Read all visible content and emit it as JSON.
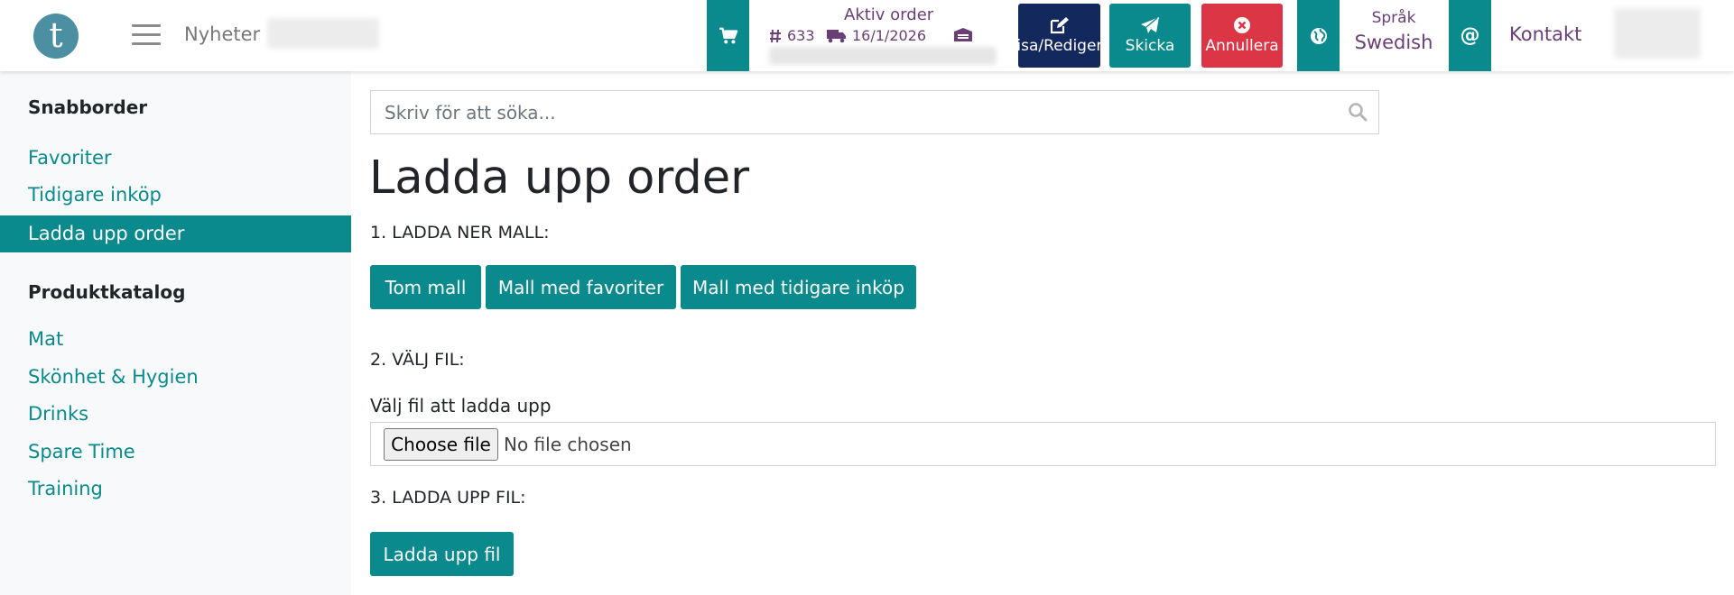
{
  "header": {
    "logo_letter": "t",
    "news_label": "Nyheter",
    "order": {
      "title": "Aktiv order",
      "number": "633",
      "date": "16/1/2026"
    },
    "actions": {
      "edit_label": "Visa/Redigera",
      "send_label": "Skicka",
      "cancel_label": "Annullera"
    },
    "language": {
      "label": "Språk",
      "value": "Swedish"
    },
    "contact_label": "Kontakt"
  },
  "sidebar": {
    "quick_order_heading": "Snabborder",
    "quick_order_items": [
      {
        "label": "Favoriter"
      },
      {
        "label": "Tidigare inköp"
      },
      {
        "label": "Ladda upp order"
      }
    ],
    "catalog_heading": "Produktkatalog",
    "catalog_items": [
      {
        "label": "Mat"
      },
      {
        "label": "Skönhet & Hygien"
      },
      {
        "label": "Drinks"
      },
      {
        "label": "Spare Time"
      },
      {
        "label": "Training"
      }
    ]
  },
  "main": {
    "search_placeholder": "Skriv för att söka...",
    "title": "Ladda upp order",
    "step1": "1. LADDA NER MALL:",
    "template_buttons": {
      "empty": "Tom mall",
      "favorites": "Mall med favoriter",
      "previous": "Mall med tidigare inköp"
    },
    "step2": "2. VÄLJ FIL:",
    "file_label": "Välj fil att ladda upp",
    "choose_file": "Choose file",
    "no_file": "No file chosen",
    "step3": "3. LADDA UPP FIL:",
    "upload_button": "Ladda upp fil"
  },
  "colors": {
    "teal": "#0a8a8c",
    "navy": "#13285c",
    "red": "#dc3545",
    "purple_text": "#6a3f77"
  },
  "icons": [
    "cart-icon",
    "hash-icon",
    "truck-icon",
    "warehouse-icon",
    "edit-icon",
    "send-icon",
    "cancel-icon",
    "globe-icon",
    "at-icon",
    "search-icon",
    "hamburger-icon"
  ]
}
